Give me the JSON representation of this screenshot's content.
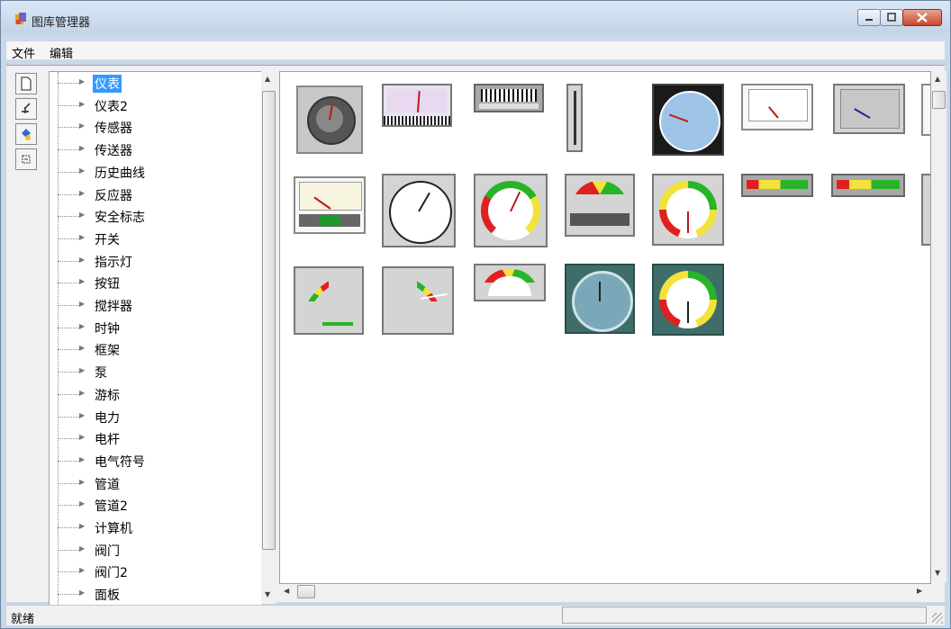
{
  "window": {
    "title": "图库管理器"
  },
  "menu": {
    "items": [
      "文件",
      "编辑"
    ]
  },
  "toolbar": {
    "buttons": [
      {
        "name": "new-icon"
      },
      {
        "name": "import-icon"
      },
      {
        "name": "paint-icon"
      },
      {
        "name": "refresh-icon"
      }
    ]
  },
  "tree": {
    "selected": "仪表",
    "items": [
      "仪表",
      "仪表2",
      "传感器",
      "传送器",
      "历史曲线",
      "反应器",
      "安全标志",
      "开关",
      "指示灯",
      "按钮",
      "搅拌器",
      "时钟",
      "框架",
      "泵",
      "游标",
      "电力",
      "电杆",
      "电气符号",
      "管道",
      "管道2",
      "计算机",
      "阀门",
      "阀门2",
      "面板"
    ]
  },
  "gallery": {
    "category": "仪表",
    "item_count": 20
  },
  "status": {
    "text": "就绪"
  },
  "colors": {
    "selection": "#3399ff",
    "close_button": "#c9462c"
  }
}
